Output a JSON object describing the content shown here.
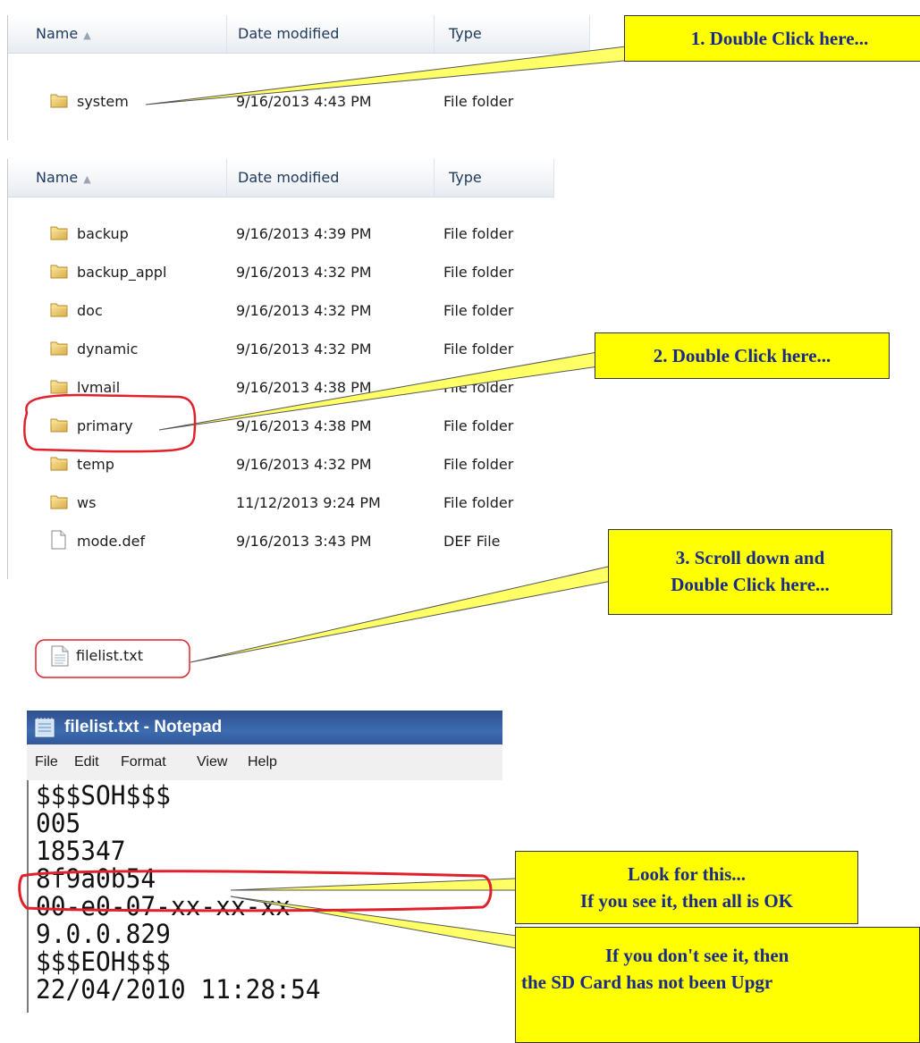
{
  "panel1": {
    "columns": {
      "name": "Name",
      "date": "Date modified",
      "type": "Type"
    },
    "rows": [
      {
        "name": "system",
        "date": "9/16/2013 4:43 PM",
        "type": "File folder",
        "icon": "folder-icon"
      }
    ]
  },
  "panel2": {
    "columns": {
      "name": "Name",
      "date": "Date modified",
      "type": "Type"
    },
    "rows": [
      {
        "name": "backup",
        "date": "9/16/2013 4:39 PM",
        "type": "File folder",
        "icon": "folder-icon"
      },
      {
        "name": "backup_appl",
        "date": "9/16/2013 4:32 PM",
        "type": "File folder",
        "icon": "folder-icon"
      },
      {
        "name": "doc",
        "date": "9/16/2013 4:32 PM",
        "type": "File folder",
        "icon": "folder-icon"
      },
      {
        "name": "dynamic",
        "date": "9/16/2013 4:32 PM",
        "type": "File folder",
        "icon": "folder-icon"
      },
      {
        "name": "lvmail",
        "date": "9/16/2013 4:38 PM",
        "type": "File folder",
        "icon": "folder-icon"
      },
      {
        "name": "primary",
        "date": "9/16/2013 4:38 PM",
        "type": "File folder",
        "icon": "folder-icon"
      },
      {
        "name": "temp",
        "date": "9/16/2013 4:32 PM",
        "type": "File folder",
        "icon": "folder-icon"
      },
      {
        "name": "ws",
        "date": "11/12/2013 9:24 PM",
        "type": "File folder",
        "icon": "folder-icon"
      },
      {
        "name": "mode.def",
        "date": "9/16/2013 3:43 PM",
        "type": "DEF File",
        "icon": "file-icon"
      }
    ]
  },
  "filelist_item": {
    "name": "filelist.txt",
    "icon": "text-file-icon"
  },
  "notepad": {
    "title": "filelist.txt - Notepad",
    "menu": [
      "File",
      "Edit",
      "Format",
      "View",
      "Help"
    ],
    "lines": [
      "$$$SOH$$$",
      "005",
      "185347",
      "8f9a0b54",
      "00-e0-07-xx-xx-xx",
      "9.0.0.829",
      "$$$EOH$$$",
      "22/04/2010   11:28:54"
    ]
  },
  "callouts": {
    "step1": "1. Double Click here...",
    "step2": "2. Double Click here...",
    "step3_line1": "3. Scroll down and",
    "step3_line2": "Double Click here...",
    "look_line1": "Look for this...",
    "look_line2": "If you see it, then all is OK",
    "missing_line1": "If you don't see it, then",
    "missing_line2": "the SD Card has not been Upgr"
  },
  "colors": {
    "callout_fill": "#ffff00",
    "callout_text": "#1a2a8a",
    "highlight_ring": "#e0202a",
    "notepad_titlebar": "#3d6cb0"
  }
}
